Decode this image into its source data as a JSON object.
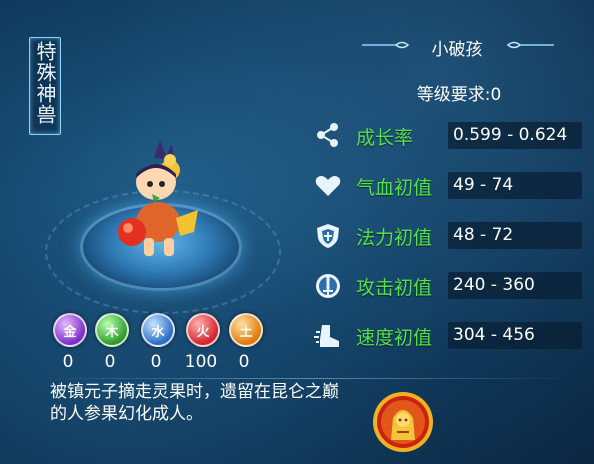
{
  "category_tag": "特殊神兽",
  "pet": {
    "name": "小破孩",
    "level_requirement": "等级要求:0"
  },
  "elements": [
    {
      "glyph": "金",
      "value": "0",
      "color": "#7b2fc4"
    },
    {
      "glyph": "木",
      "value": "0",
      "color": "#2f9c2a"
    },
    {
      "glyph": "水",
      "value": "0",
      "color": "#2c6cc8"
    },
    {
      "glyph": "火",
      "value": "100",
      "color": "#d3232b"
    },
    {
      "glyph": "土",
      "value": "0",
      "color": "#e07a10"
    }
  ],
  "stats": [
    {
      "label": "成长率",
      "value": "0.599 - 0.624",
      "icon": "share-icon"
    },
    {
      "label": "气血初值",
      "value": "49 - 74",
      "icon": "heart-icon"
    },
    {
      "label": "法力初值",
      "value": "48 - 72",
      "icon": "shield-icon"
    },
    {
      "label": "攻击初值",
      "value": "240 - 360",
      "icon": "sword-icon"
    },
    {
      "label": "速度初值",
      "value": "304 - 456",
      "icon": "boot-icon"
    }
  ],
  "description": "被镇元子摘走灵果时，遗留在昆仑之巅的人参果幻化成人。",
  "colors": {
    "stat_label": "#55e04a",
    "text": "#ffffff",
    "accent": "#8fd3ff"
  }
}
